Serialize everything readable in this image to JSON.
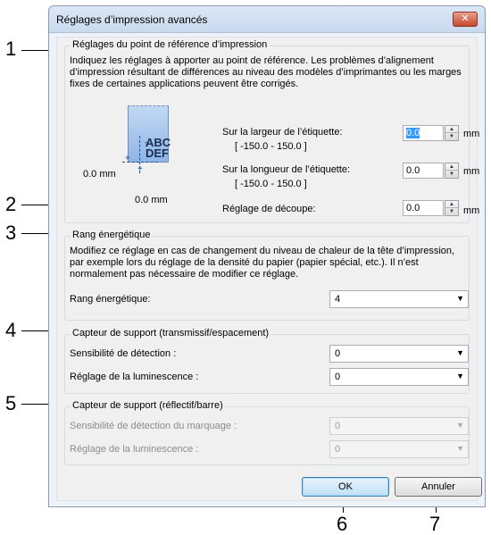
{
  "dialog": {
    "title": "Réglages d’impression avancés",
    "close_icon": "close-icon"
  },
  "callouts": [
    "1",
    "2",
    "3",
    "4",
    "5",
    "6",
    "7"
  ],
  "reference_point": {
    "group_label": "Réglages du point de référence d’impression",
    "description": "Indiquez les réglages à apporter au point de référence. Les problèmes d’alignement d’impression résultant de différences au niveau des modèles d’imprimantes ou les marges fixes de certaines applications peuvent être corrigés.",
    "illustration": {
      "text_line1": "ABC",
      "text_line2": "DEF",
      "x_offset": "0.0 mm",
      "y_offset": "0.0 mm"
    },
    "width_label": "Sur la largeur de l’étiquette:",
    "width_range": "[ -150.0 - 150.0 ]",
    "width_value": "0.0",
    "length_label": "Sur la longueur de l’étiquette:",
    "length_range": "[ -150.0 - 150.0 ]",
    "length_value": "0.0",
    "cut_label": "Réglage de découpe:",
    "cut_value": "0.0",
    "unit": "mm"
  },
  "energy": {
    "group_label": "Rang énergétique",
    "description": "Modifiez ce réglage en cas de changement du niveau de chaleur de la tête d’impression, par exemple lors du réglage de la densité du papier (papier spécial, etc.). Il n’est normalement pas nécessaire de modifier ce réglage.",
    "field_label": "Rang énergétique:",
    "value": "4"
  },
  "transmissive_sensor": {
    "group_label": "Capteur de support (transmissif/espacement)",
    "sensitivity_label": "Sensibilité de détection :",
    "sensitivity_value": "0",
    "luminescence_label": "Réglage de la luminescence :",
    "luminescence_value": "0"
  },
  "reflective_sensor": {
    "group_label": "Capteur de support (réflectif/barre)",
    "sensitivity_label": "Sensibilité de détection du marquage :",
    "sensitivity_value": "0",
    "luminescence_label": "Réglage de la luminescence :",
    "luminescence_value": "0"
  },
  "buttons": {
    "ok": "OK",
    "cancel": "Annuler"
  },
  "colors": {
    "accent": "#3399ff",
    "close": "#c6462e"
  }
}
